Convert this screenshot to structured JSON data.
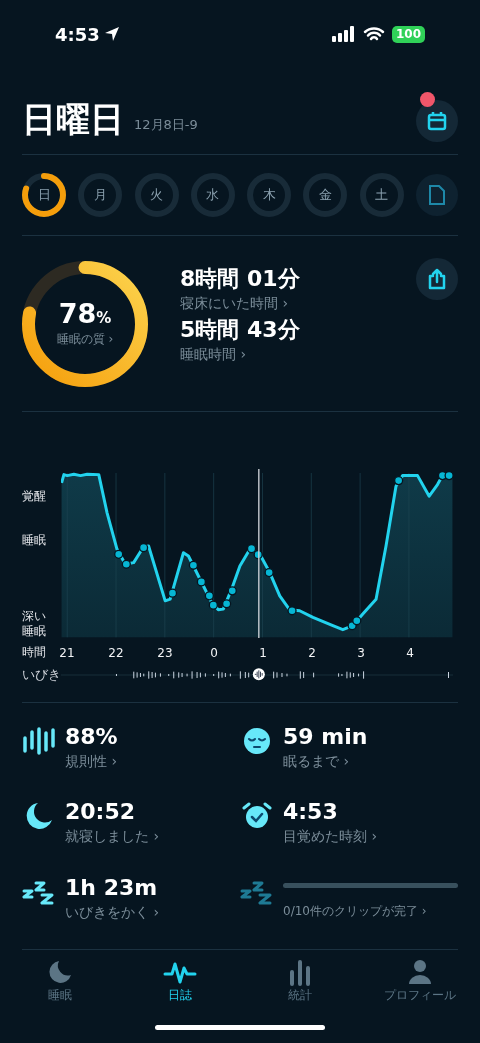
{
  "status_bar": {
    "time": "4:53",
    "battery": "100"
  },
  "header": {
    "title": "日曜日",
    "subtitle": "12月8日-9",
    "notification_dot": true
  },
  "week": [
    {
      "label": "日",
      "selected": true
    },
    {
      "label": "月",
      "selected": false
    },
    {
      "label": "火",
      "selected": false
    },
    {
      "label": "水",
      "selected": false
    },
    {
      "label": "木",
      "selected": false
    },
    {
      "label": "金",
      "selected": false
    },
    {
      "label": "土",
      "selected": false
    }
  ],
  "summary": {
    "score": "78",
    "score_unit": "%",
    "score_label": "睡眠の質 ›",
    "time_in_bed": "8時間 01分",
    "time_in_bed_label": "寝床にいた時間 ›",
    "sleep_time": "5時間 43分",
    "sleep_time_label": "睡眠時間 ›"
  },
  "sleep_graph": {
    "y_labels": [
      "覚醒",
      "睡眠",
      "深い睡眠"
    ],
    "x_title": "時間",
    "x_labels": [
      "21",
      "22",
      "23",
      "0",
      "1",
      "2",
      "3",
      "4"
    ],
    "snore_label": "いびき"
  },
  "stats": [
    {
      "kind": "stat",
      "value": "88%",
      "label": "規則性 ›"
    },
    {
      "kind": "stat",
      "value": "59 min",
      "label": "眠るまで ›"
    },
    {
      "kind": "stat",
      "value": "20:52",
      "label": "就寝しました ›"
    },
    {
      "kind": "stat",
      "value": "4:53",
      "label": "目覚めた時刻 ›"
    },
    {
      "kind": "stat",
      "value": "1h 23m",
      "label": "いびきをかく ›"
    },
    {
      "kind": "progress",
      "label": "0/10件のクリップが完了 ›"
    }
  ],
  "tabs": [
    {
      "label": "睡眠",
      "selected": false
    },
    {
      "label": "日誌",
      "selected": true
    },
    {
      "label": "統計",
      "selected": false
    },
    {
      "label": "プロフィール",
      "selected": false
    }
  ]
}
